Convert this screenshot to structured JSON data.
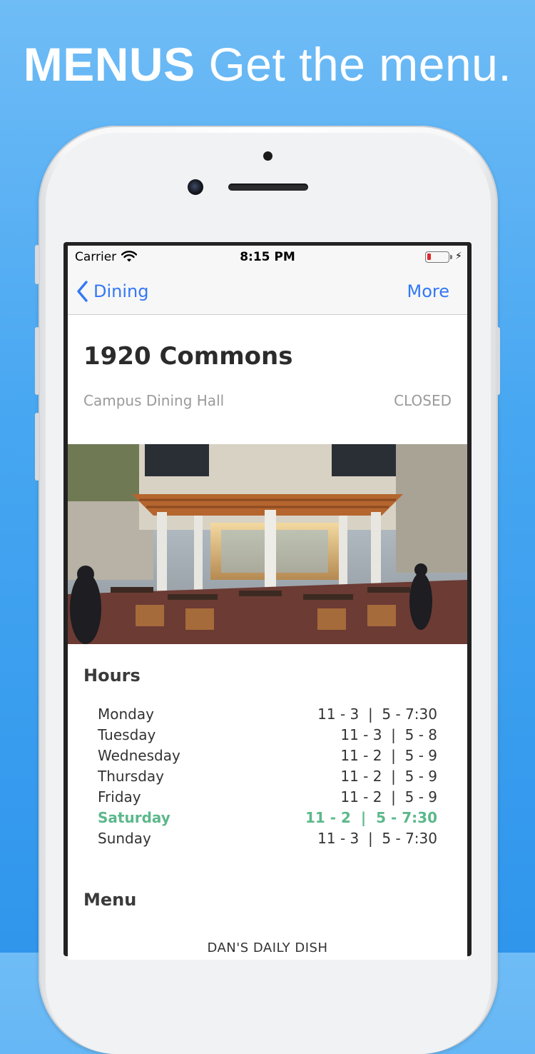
{
  "promo": {
    "bold": "MENUS",
    "rest": "Get the menu."
  },
  "status_bar": {
    "carrier": "Carrier",
    "time": "8:15 PM"
  },
  "nav": {
    "back_label": "Dining",
    "more_label": "More"
  },
  "hall": {
    "name": "1920 Commons",
    "type": "Campus Dining Hall",
    "status": "CLOSED"
  },
  "hours": {
    "title": "Hours",
    "rows": [
      {
        "day": "Monday",
        "time": "11 - 3  |  5 - 7:30"
      },
      {
        "day": "Tuesday",
        "time": "11 - 3  |  5 - 8"
      },
      {
        "day": "Wednesday",
        "time": "11 - 2  |  5 - 9"
      },
      {
        "day": "Thursday",
        "time": "11 - 2  |  5 - 9"
      },
      {
        "day": "Friday",
        "time": "11 - 2  |  5 - 9"
      },
      {
        "day": "Saturday",
        "time": "11 - 2  |  5 - 7:30"
      },
      {
        "day": "Sunday",
        "time": "11 - 3  |  5 - 7:30"
      }
    ],
    "today_index": 5
  },
  "menu": {
    "title": "Menu",
    "station": "DAN'S DAILY DISH"
  },
  "colors": {
    "accent": "#3478f6",
    "today": "#5cb88b",
    "background": "#46a6f1"
  }
}
